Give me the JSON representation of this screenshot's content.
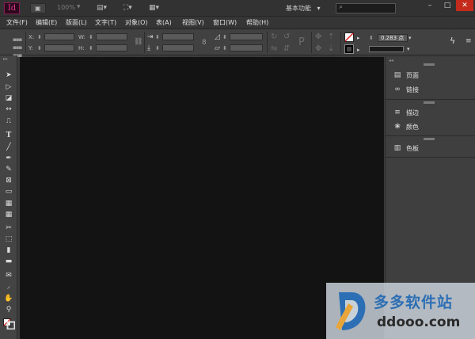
{
  "app": {
    "logo_text": "Id",
    "zoom_value": "100%",
    "workspace_label": "基本功能",
    "workspace_arrow": "▾",
    "search_placeholder": ""
  },
  "window_controls": {
    "minimize": "–",
    "maximize": "□",
    "close": "✕"
  },
  "menu": [
    "文件(F)",
    "编辑(E)",
    "版面(L)",
    "文字(T)",
    "对象(O)",
    "表(A)",
    "视图(V)",
    "窗口(W)",
    "帮助(H)"
  ],
  "control": {
    "x_label": "X:",
    "y_label": "Y:",
    "w_label": "W:",
    "h_label": "H:",
    "stroke_weight": "0.283 点"
  },
  "dock": {
    "groups": [
      [
        {
          "icon": "pages-icon",
          "label": "页面"
        },
        {
          "icon": "links-icon",
          "label": "链接"
        }
      ],
      [
        {
          "icon": "stroke-icon",
          "label": "描边"
        },
        {
          "icon": "color-icon",
          "label": "颜色"
        }
      ],
      [
        {
          "icon": "swatches-icon",
          "label": "色板"
        }
      ]
    ]
  },
  "tools": [
    "selection-tool-icon",
    "direct-selection-tool-icon",
    "page-tool-icon",
    "gap-tool-icon",
    "content-collector-icon",
    "type-tool-icon",
    "line-tool-icon",
    "pen-tool-icon",
    "pencil-tool-icon",
    "rectangle-frame-tool-icon",
    "rectangle-tool-icon",
    "table-tool-icon",
    "grid-tool-icon",
    "scissors-tool-icon",
    "free-transform-tool-icon",
    "gradient-swatch-tool-icon",
    "gradient-feather-tool-icon",
    "note-tool-icon",
    "eyedropper-tool-icon",
    "hand-tool-icon",
    "zoom-tool-icon",
    "fill-stroke-icon"
  ],
  "watermark": {
    "cn_text": "多多软件站",
    "en_text": "ddooo.com",
    "brand_color": "#2d6fb5"
  }
}
